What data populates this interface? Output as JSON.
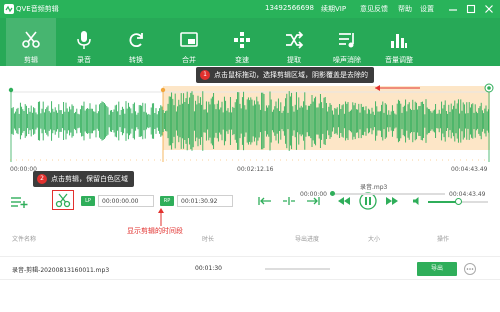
{
  "app": {
    "title": "QVE音频剪辑"
  },
  "header": {
    "phone": "13492566698",
    "vip": "续期VIP",
    "feedback": "意见反馈",
    "help": "帮助",
    "settings": "设置"
  },
  "tools": [
    {
      "label": "剪辑",
      "icon": "scissors-icon"
    },
    {
      "label": "录音",
      "icon": "microphone-icon"
    },
    {
      "label": "转换",
      "icon": "refresh-icon"
    },
    {
      "label": "合并",
      "icon": "merge-icon"
    },
    {
      "label": "变速",
      "icon": "speed-icon"
    },
    {
      "label": "提取",
      "icon": "shuffle-icon"
    },
    {
      "label": "噪声消除",
      "icon": "noise-removal-icon"
    },
    {
      "label": "音量调整",
      "icon": "volume-bars-icon"
    }
  ],
  "annotations": {
    "callout1": {
      "num": "1",
      "text": "点击鼠标拖动，选择剪辑区域，阴影覆盖是去除的"
    },
    "callout2": {
      "num": "2",
      "text": "点击剪辑，保留白色区域"
    },
    "hint": "显示剪辑的时间段"
  },
  "timeline": {
    "start": "00:00:00",
    "mid": "00:02:12.16",
    "end": "00:04:43.49"
  },
  "controls": {
    "start_time": "00:00:00.00",
    "end_time": "00:01:30.92",
    "badge_start": "LP",
    "badge_end": "RP",
    "file_name": "录音.mp3",
    "current_time": "00:00:00",
    "total_time": "00:04:43.49"
  },
  "table": {
    "headers": [
      "文件名称",
      "时长",
      "导出进度",
      "大小",
      "操作"
    ],
    "rows": [
      {
        "name": "录音-剪辑-20200813160011.mp3",
        "duration": "00:01:30",
        "export_label": "导出"
      }
    ]
  },
  "colors": {
    "primary": "#27a957",
    "accent": "#2fae5a",
    "shade": "#fde6c7",
    "wave": "#2fae5a",
    "callout_num": "#e2312e"
  }
}
